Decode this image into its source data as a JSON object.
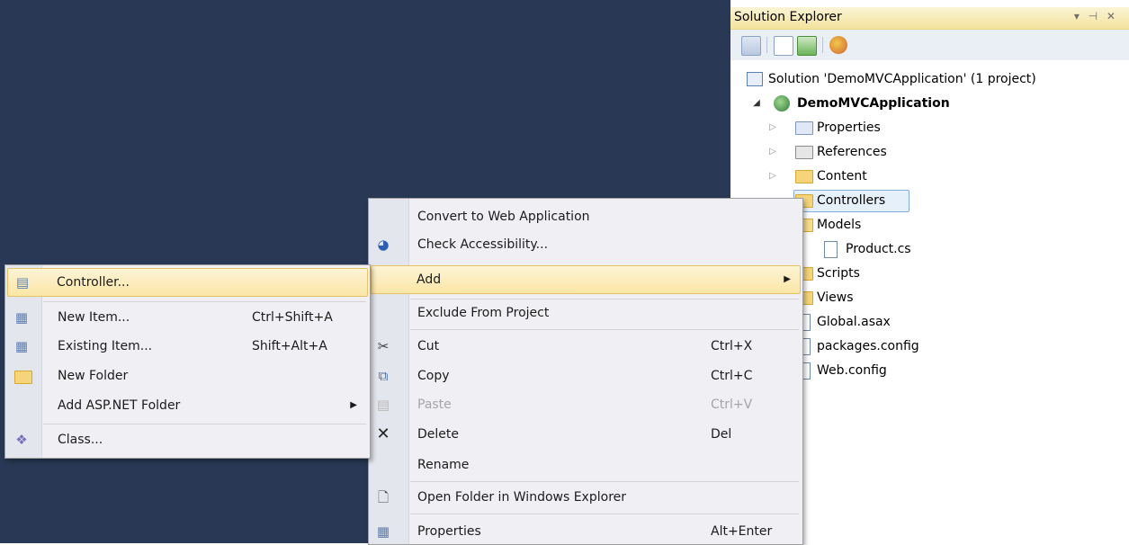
{
  "solution_explorer": {
    "title": "Solution Explorer",
    "title_controls": "▾ ⊣ ✕",
    "toolbar_icons": [
      "properties-icon",
      "show-all-files-icon",
      "refresh-icon",
      "view-class-diagram-icon"
    ],
    "tree": {
      "solution": "Solution 'DemoMVCApplication' (1 project)",
      "project": "DemoMVCApplication",
      "items": [
        {
          "label": "Properties",
          "icon": "properties-folder-icon",
          "expand": "▷"
        },
        {
          "label": "References",
          "icon": "references-icon",
          "expand": "▷"
        },
        {
          "label": "Content",
          "icon": "folder-icon",
          "expand": "▷"
        },
        {
          "label": "Controllers",
          "icon": "folder-icon",
          "expand": ""
        },
        {
          "label": "Models",
          "icon": "folder-open-icon",
          "expand": ""
        },
        {
          "label": "Product.cs",
          "icon": "cs-file-icon",
          "expand": ""
        },
        {
          "label": "Scripts",
          "icon": "folder-icon",
          "expand": ""
        },
        {
          "label": "Views",
          "icon": "folder-icon",
          "expand": ""
        },
        {
          "label": "Global.asax",
          "icon": "asax-file-icon",
          "expand": ""
        },
        {
          "label": "packages.config",
          "icon": "config-file-icon",
          "expand": ""
        },
        {
          "label": "Web.config",
          "icon": "config-file-icon",
          "expand": ""
        }
      ]
    }
  },
  "context_menu": {
    "items": [
      {
        "label": "Convert to Web Application",
        "shortcut": "",
        "icon": ""
      },
      {
        "label": "Check Accessibility...",
        "shortcut": "",
        "icon": "accessibility-icon"
      },
      {
        "label": "Add",
        "shortcut": "",
        "icon": "",
        "submenu_arrow": "▶"
      },
      {
        "label": "Exclude From Project",
        "shortcut": "",
        "icon": ""
      },
      {
        "label": "Cut",
        "shortcut": "Ctrl+X",
        "icon": "cut-icon"
      },
      {
        "label": "Copy",
        "shortcut": "Ctrl+C",
        "icon": "copy-icon"
      },
      {
        "label": "Paste",
        "shortcut": "Ctrl+V",
        "icon": "paste-icon"
      },
      {
        "label": "Delete",
        "shortcut": "Del",
        "icon": "delete-icon"
      },
      {
        "label": "Rename",
        "shortcut": "",
        "icon": ""
      },
      {
        "label": "Open Folder in Windows Explorer",
        "shortcut": "",
        "icon": "open-folder-icon"
      },
      {
        "label": "Properties",
        "shortcut": "Alt+Enter",
        "icon": "properties-icon"
      }
    ]
  },
  "add_submenu": {
    "items": [
      {
        "label": "Controller...",
        "shortcut": "",
        "icon": "controller-icon"
      },
      {
        "label": "New Item...",
        "shortcut": "Ctrl+Shift+A",
        "icon": "new-item-icon"
      },
      {
        "label": "Existing Item...",
        "shortcut": "Shift+Alt+A",
        "icon": "existing-item-icon"
      },
      {
        "label": "New Folder",
        "shortcut": "",
        "icon": "new-folder-icon"
      },
      {
        "label": "Add ASP.NET Folder",
        "shortcut": "",
        "icon": "",
        "submenu_arrow": "▶"
      },
      {
        "label": "Class...",
        "shortcut": "",
        "icon": "class-icon"
      }
    ]
  },
  "colors": {
    "editor_background": "#293955",
    "highlight": "#fbe6a6",
    "selection": "#e6f0fb"
  }
}
